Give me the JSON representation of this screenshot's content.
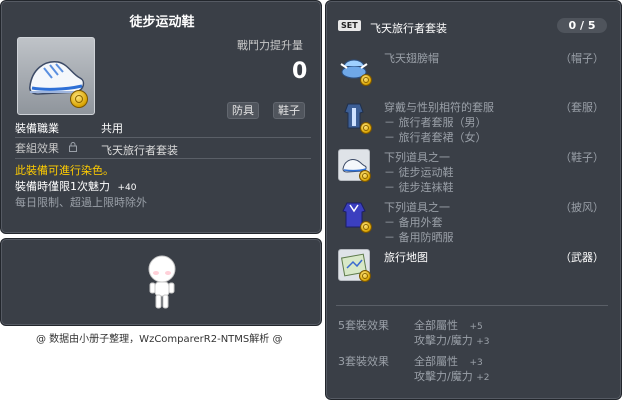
{
  "item": {
    "id": "01073943",
    "name": "徒步运动鞋",
    "power_label": "戰鬥力提升量",
    "power_value": "0",
    "tags": [
      "防具",
      "鞋子"
    ],
    "job_label": "裝備職業",
    "job_value": "共用",
    "set_label": "套組效果",
    "set_value": "飞天旅行者套装",
    "dye_note": "此裝備可進行染色。",
    "time_limit_text": "裝備時僅限1次魅力",
    "time_limit_value": "+40",
    "daily_limit_text": "每日限制、超過上限時除外"
  },
  "footer": {
    "credit": "@ 数据由小册子整理，WzComparerR2-NTMS解析 @"
  },
  "set_panel": {
    "badge": "SET",
    "name": "飞天旅行者套装",
    "count": "0 / 5",
    "items": [
      {
        "icon": "wing-hat-icon",
        "name": "飞天翅膀帽",
        "lines": [],
        "slot": "（帽子）"
      },
      {
        "icon": "overall-icon",
        "name": "穿戴与性别相符的套服",
        "lines": [
          "－ 旅行者套服（男）",
          "－ 旅行者套裙（女）"
        ],
        "slot": "（套服）"
      },
      {
        "icon": "shoes-icon",
        "name": "下列道具之一",
        "lines": [
          "－ 徒步运动鞋",
          "－ 徒步连袜鞋"
        ],
        "slot": "（鞋子）"
      },
      {
        "icon": "cape-icon",
        "name": "下列道具之一",
        "lines": [
          "－ 备用外套",
          "－ 备用防晒服"
        ],
        "slot": "（披风）"
      },
      {
        "icon": "map-icon",
        "name": "旅行地图",
        "lines": [],
        "slot": "（武器）"
      }
    ],
    "effects": [
      {
        "label": "5套裝效果",
        "stats": [
          {
            "name": "全部屬性",
            "value": "+5"
          },
          {
            "name": "攻擊力/魔力",
            "value": "+3"
          }
        ]
      },
      {
        "label": "3套裝效果",
        "stats": [
          {
            "name": "全部屬性",
            "value": "+3"
          },
          {
            "name": "攻擊力/魔力",
            "value": "+2"
          }
        ]
      }
    ]
  },
  "colors": {
    "panel_bg": "#3a3f47",
    "dye_note": "#ffcc00",
    "muted_text": "#9aa0a8"
  }
}
